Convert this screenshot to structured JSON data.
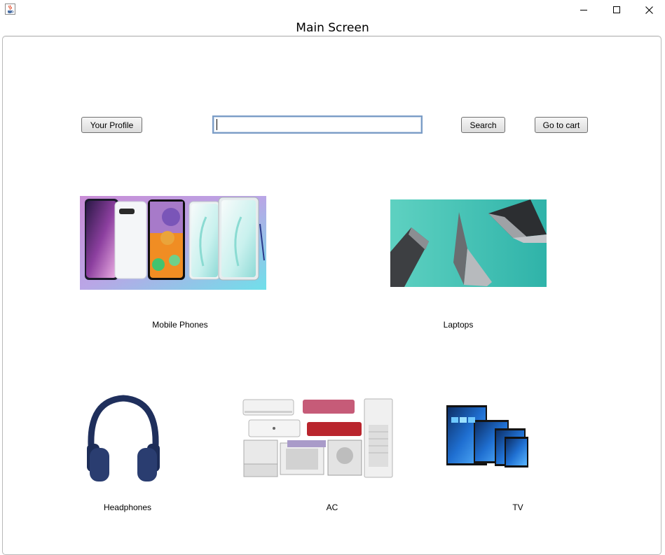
{
  "window": {
    "title": "Main Screen",
    "icon": "java-cup-icon",
    "controls": [
      "minimize-icon",
      "maximize-icon",
      "close-icon"
    ]
  },
  "toolbar": {
    "profile_label": "Your Profile",
    "search_value": "",
    "search_label": "Search",
    "cart_label": "Go to cart"
  },
  "categories": [
    {
      "label": "Mobile Phones",
      "image": "smartphones-image"
    },
    {
      "label": "Laptops",
      "image": "laptops-image"
    },
    {
      "label": "Headphones",
      "image": "headphones-image"
    },
    {
      "label": "AC",
      "image": "air-conditioners-image"
    },
    {
      "label": "TV",
      "image": "televisions-image"
    }
  ]
}
